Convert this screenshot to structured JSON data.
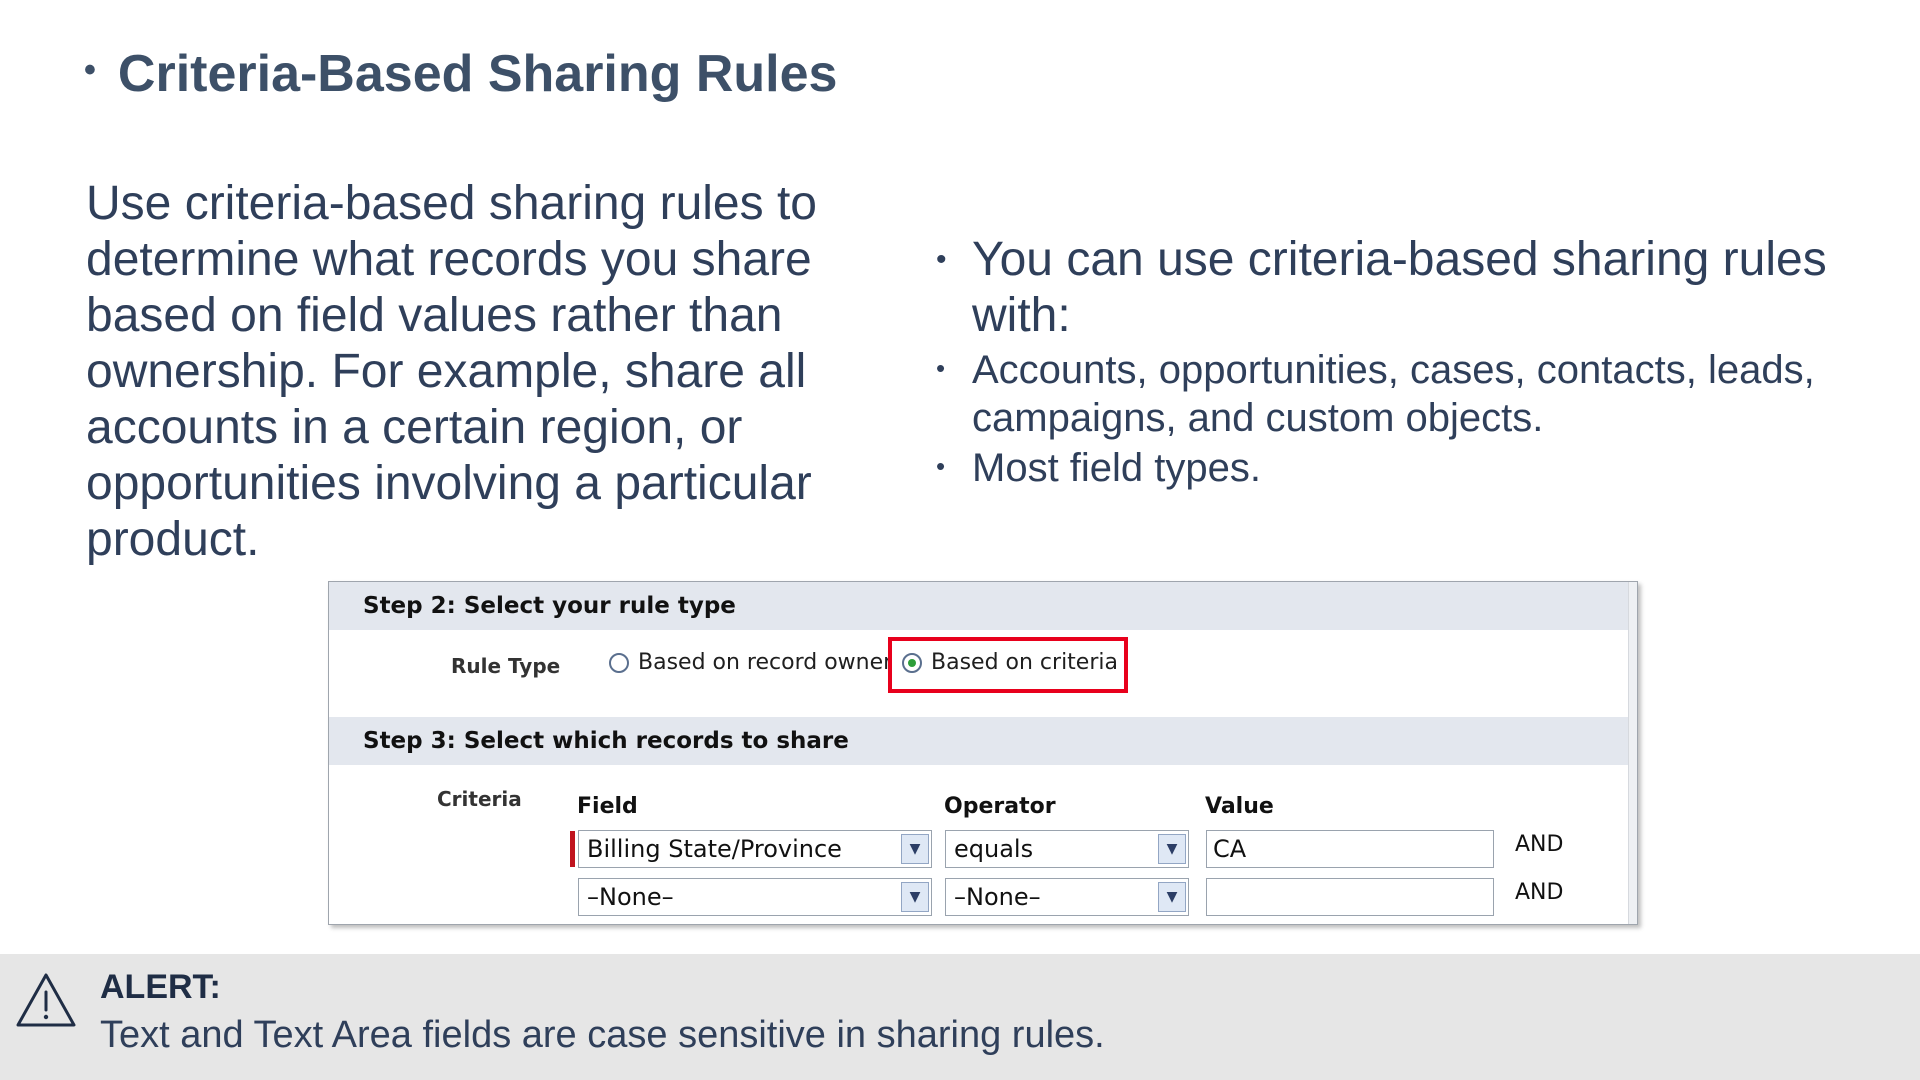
{
  "slide": {
    "title": "Criteria-Based Sharing Rules",
    "title_bullet": "•",
    "intro": "Use criteria-based sharing rules to determine what records you share based on field values rather than ownership. For example, share all accounts in a certain region, or opportunities involving a particular product.",
    "bullets": {
      "main": "You can use criteria-based sharing rules with:",
      "subs": [
        "Accounts, opportunities, cases, contacts, leads, campaigns, and custom objects.",
        "Most field types."
      ]
    }
  },
  "screenshot": {
    "step2_header": "Step 2: Select your rule type",
    "rule_type_label": "Rule Type",
    "radio_owner": "Based on record owner",
    "radio_criteria": "Based on criteria",
    "selected_radio": "criteria",
    "highlight_color": "#e8001c",
    "step3_header": "Step 3: Select which records to share",
    "criteria_label": "Criteria",
    "columns": {
      "field": "Field",
      "operator": "Operator",
      "value": "Value"
    },
    "rows": [
      {
        "field": "Billing State/Province",
        "operator": "equals",
        "value": "CA",
        "conjunction": "AND"
      },
      {
        "field": "–None–",
        "operator": "–None–",
        "value": "",
        "conjunction": "AND"
      }
    ]
  },
  "alert": {
    "icon": "warning-triangle-icon",
    "title": "ALERT:",
    "text": "Text and Text Area fields are case sensitive in sharing rules."
  }
}
